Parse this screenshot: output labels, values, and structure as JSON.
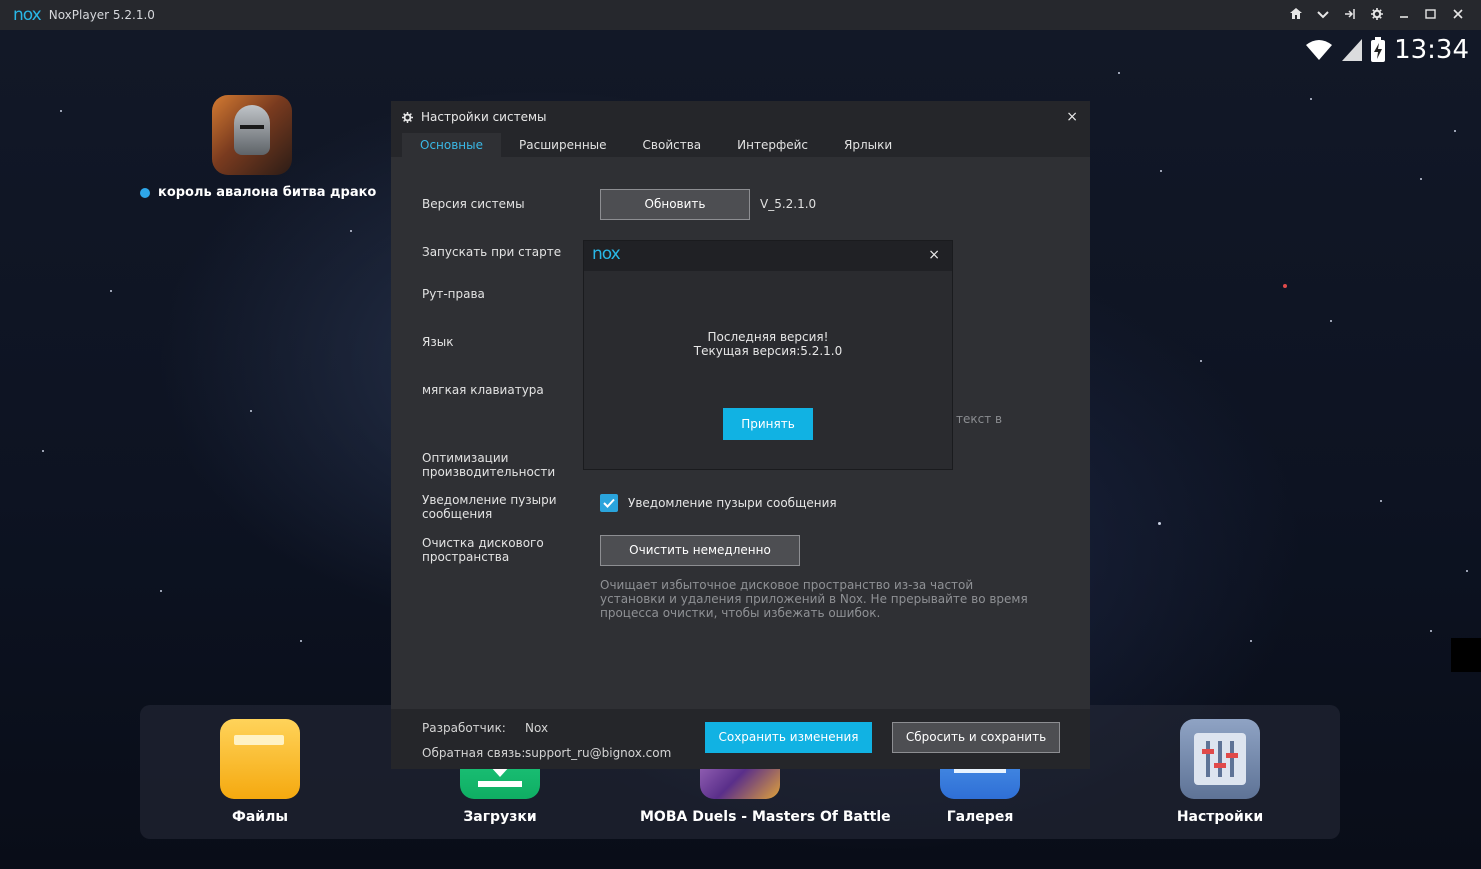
{
  "window": {
    "logo": "nox",
    "title": "NoxPlayer 5.2.1.0",
    "controls": [
      "home-icon",
      "chevron-down-icon",
      "pin-icon",
      "gear-icon",
      "minimize-icon",
      "maximize-icon",
      "close-icon"
    ]
  },
  "status_bar": {
    "clock": "13:34",
    "icons": [
      "wifi-icon",
      "signal-icon",
      "battery-icon"
    ]
  },
  "desktop": {
    "game_label": "король авалона битва драконов",
    "dock": [
      {
        "label": "Файлы"
      },
      {
        "label": "Загрузки"
      },
      {
        "label": "MOBA Duels - Masters Of Battle"
      },
      {
        "label": "Галерея"
      },
      {
        "label": "Настройки"
      }
    ]
  },
  "settings": {
    "title": "Настройки системы",
    "close": "×",
    "tabs": [
      {
        "label": "Основные",
        "active": true
      },
      {
        "label": "Расширенные",
        "active": false
      },
      {
        "label": "Свойства",
        "active": false
      },
      {
        "label": "Интерфейс",
        "active": false
      },
      {
        "label": "Ярлыки",
        "active": false
      }
    ],
    "rows": {
      "system_version": "Версия системы",
      "autostart": "Запускать при старте",
      "root": "Рут-права",
      "language": "Язык",
      "soft_keyboard": "мягкая клавиатура",
      "optimization": "Оптимизации производительности",
      "bubble_notify": "Уведомление пузыри сообщения",
      "disk_cleanup": "Очистка дискового пространства"
    },
    "update_button": "Обновить",
    "version_value": "V_5.2.1.0",
    "faded_text": "текст в",
    "bubble_checkbox_label": "Уведомление пузыри сообщения",
    "bubble_checked": true,
    "clean_button": "Очистить немедленно",
    "clean_hint": "Очищает избыточное дисковое пространство из-за частой установки и удаления приложений в Nox. Не прерывайте во время процесса очистки, чтобы избежать ошибок.",
    "footer": {
      "developer_label": "Разработчик:",
      "developer_value": "Nox",
      "feedback_label": "Обратная связь:",
      "feedback_value": "support_ru@bignox.com",
      "save_button": "Сохранить изменения",
      "reset_button": "Сбросить и сохранить"
    }
  },
  "popup": {
    "logo": "nox",
    "close": "×",
    "line1": "Последняя версия!",
    "line2": "Текущая версия:5.2.1.0",
    "accept_button": "Принять"
  },
  "colors": {
    "accent": "#11b2e3",
    "titlebar": "#26282d",
    "dialog_bg": "#2f3034",
    "dialog_header": "#25262a"
  }
}
